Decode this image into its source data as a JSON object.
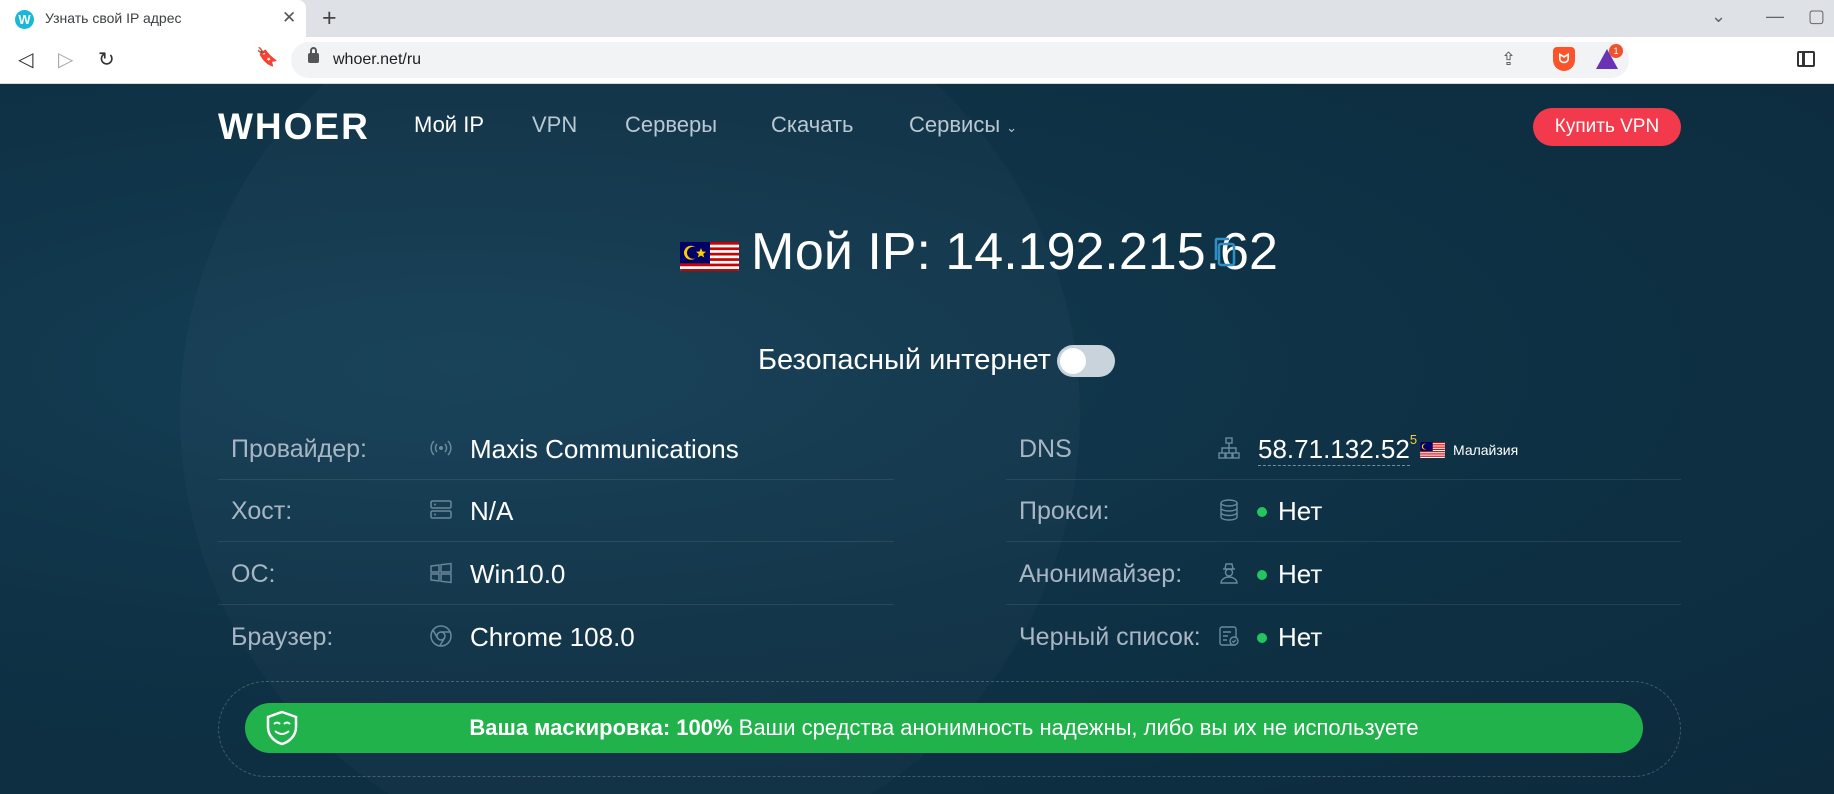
{
  "browser": {
    "tab_title": "Узнать свой IP адрес",
    "tab_favicon": "W",
    "url": "whoer.net/ru",
    "extension_badge": "1"
  },
  "header": {
    "logo": "WHOER",
    "nav": [
      "Мой IP",
      "VPN",
      "Серверы",
      "Скачать",
      "Сервисы"
    ],
    "buy_button": "Купить VPN"
  },
  "ip": {
    "label": "Мой IP:",
    "address": "14.192.215.62",
    "flag": "malaysia-flag"
  },
  "safe_internet": {
    "label": "Безопасный интернет",
    "enabled": false
  },
  "left_info": [
    {
      "label": "Провайдер:",
      "value": "Maxis Communications",
      "icon": "signal-icon"
    },
    {
      "label": "Хост:",
      "value": "N/A",
      "icon": "server-icon"
    },
    {
      "label": "ОС:",
      "value": "Win10.0",
      "icon": "windows-icon"
    },
    {
      "label": "Браузер:",
      "value": "Chrome 108.0",
      "icon": "chrome-icon"
    }
  ],
  "right_info": {
    "dns": {
      "label": "DNS",
      "value": "58.71.132.52",
      "sup": "5",
      "country": "Малайзия",
      "icon": "network-icon"
    },
    "proxy": {
      "label": "Прокси:",
      "value": "Нет",
      "icon": "database-icon"
    },
    "anonymizer": {
      "label": "Анонимайзер:",
      "value": "Нет",
      "icon": "spy-icon"
    },
    "blacklist": {
      "label": "Черный список:",
      "value": "Нет",
      "icon": "list-check-icon"
    }
  },
  "masking": {
    "prefix": "Ваша маскировка: 100%",
    "text": " Ваши средства анонимность надежны, либо вы их не используете"
  },
  "colors": {
    "page_bg": "#0f3246",
    "accent_red": "#f23a4c",
    "success_green": "#22b24c",
    "status_dot": "#22c55e"
  }
}
